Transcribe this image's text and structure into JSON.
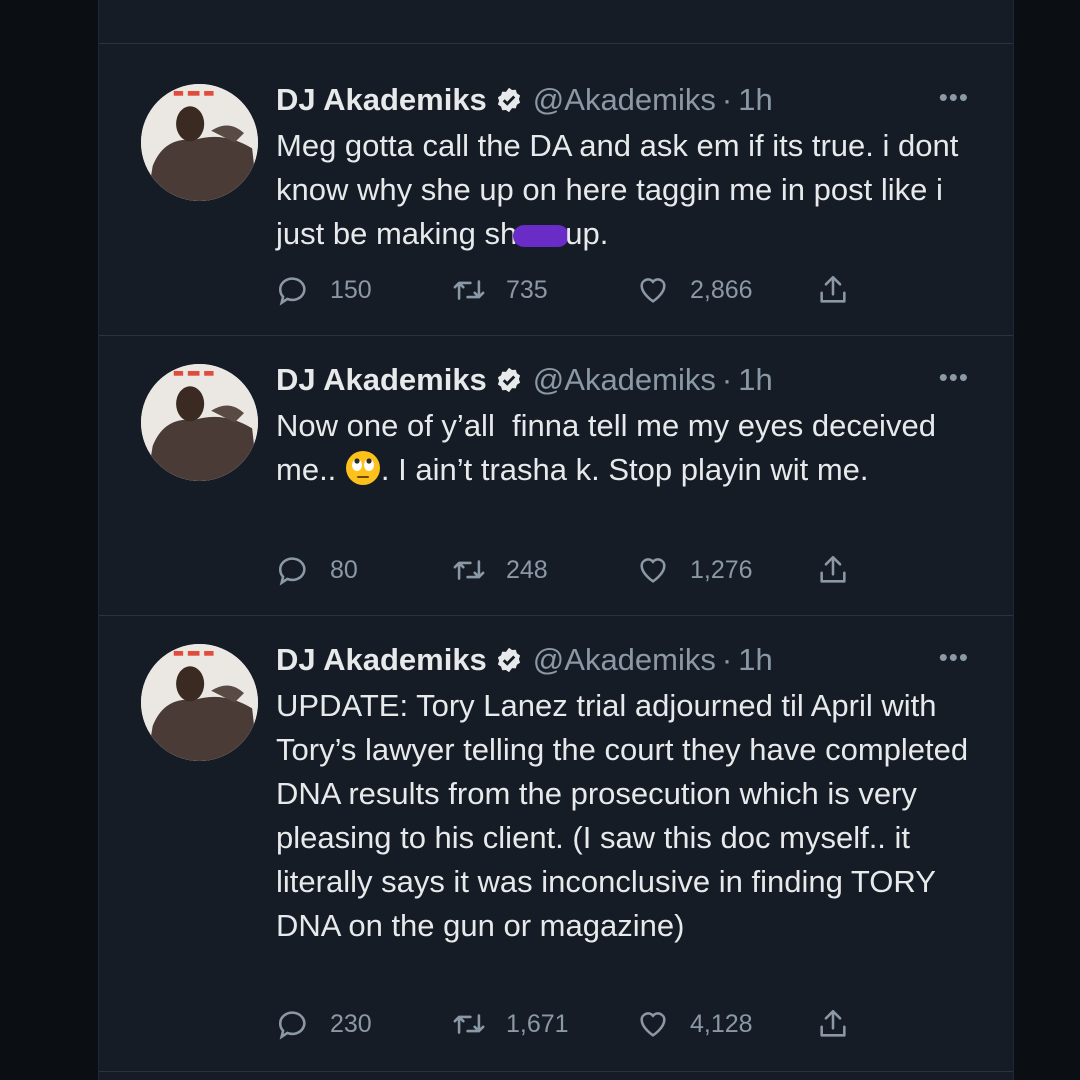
{
  "tweets": [
    {
      "display_name": "DJ Akademiks",
      "handle": "@Akademiks",
      "time": "1h",
      "text_before": "Meg gotta call the DA and ask em if its true. i dont know why she up on here taggin me in post like i just be making sh",
      "text_after": "up.",
      "replies": "150",
      "retweets": "735",
      "likes": "2,866"
    },
    {
      "display_name": "DJ Akademiks",
      "handle": "@Akademiks",
      "time": "1h",
      "text_before": "Now one of y’all  finna tell me my eyes deceived me.. ",
      "text_after": ". I ain’t trasha k. Stop playin wit me.",
      "replies": "80",
      "retweets": "248",
      "likes": "1,276"
    },
    {
      "display_name": "DJ Akademiks",
      "handle": "@Akademiks",
      "time": "1h",
      "text_before": "UPDATE: Tory Lanez trial adjourned til April with Tory’s lawyer telling the court they have completed DNA results from the prosecution which is very pleasing to his client. (I saw this doc myself.. it literally says it was inconclusive in finding TORY DNA on the gun or magazine)",
      "text_after": "",
      "replies": "230",
      "retweets": "1,671",
      "likes": "4,128"
    }
  ],
  "dot_separator": "·",
  "more_glyph": "•••",
  "icons": {
    "verified": "verified-badge-icon",
    "reply": "reply-icon",
    "retweet": "retweet-icon",
    "like": "heart-icon",
    "share": "share-icon",
    "more": "more-icon"
  },
  "colors": {
    "background": "#151c26",
    "text_primary": "#e7e9ea",
    "text_secondary": "#8b98a5",
    "divider": "#2a3441",
    "redaction": "#6a2cc7"
  }
}
